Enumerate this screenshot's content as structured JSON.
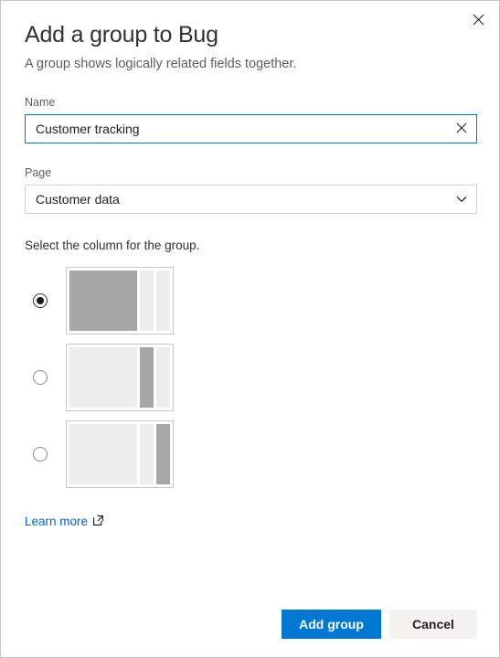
{
  "dialog": {
    "title": "Add a group to Bug",
    "subtitle": "A group shows logically related fields together.",
    "close_icon": "close-icon"
  },
  "name_field": {
    "label": "Name",
    "value": "Customer tracking",
    "placeholder": "",
    "clear_icon": "clear-icon"
  },
  "page_field": {
    "label": "Page",
    "value": "Customer data",
    "caret_icon": "chevron-down-icon",
    "options": [
      "Customer data"
    ]
  },
  "column_choice": {
    "label": "Select the column for the group.",
    "selected_index": 0,
    "options": [
      {
        "name": "first-column",
        "active_column": 1
      },
      {
        "name": "second-column",
        "active_column": 2
      },
      {
        "name": "third-column",
        "active_column": 3
      }
    ]
  },
  "learn_more": {
    "label": "Learn more",
    "icon": "external-link-icon"
  },
  "footer": {
    "primary_label": "Add group",
    "secondary_label": "Cancel"
  },
  "colors": {
    "accent": "#0078d4",
    "link": "#0066cc",
    "active_column": "#a6a6a6",
    "inactive_column": "#ededed",
    "border": "#c8c6c4",
    "text": "#323130",
    "muted_text": "#605e5c"
  }
}
